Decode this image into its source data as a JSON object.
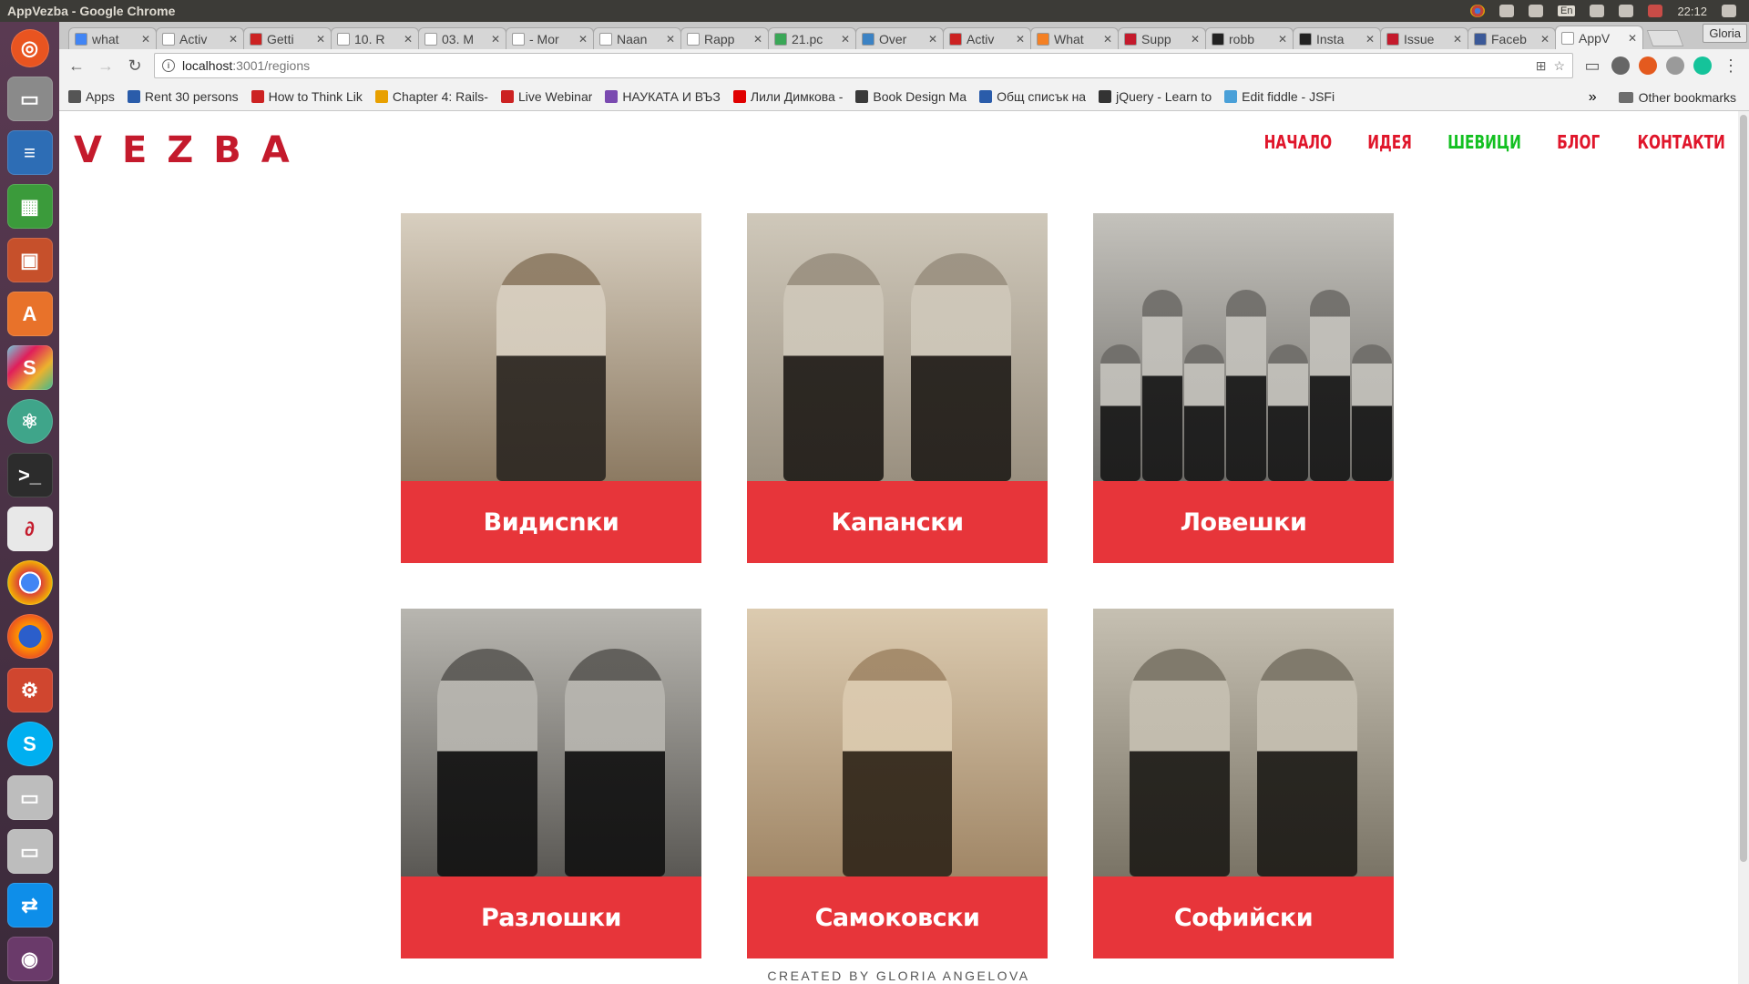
{
  "os": {
    "window_title": "AppVezba - Google Chrome",
    "clock": "22:12",
    "lang": "En"
  },
  "browser": {
    "user": "Gloria",
    "tabs": [
      {
        "label": "what",
        "color": "#4285f4"
      },
      {
        "label": "Activ",
        "color": "#ffffff"
      },
      {
        "label": "Getti",
        "color": "#cc2222"
      },
      {
        "label": "10. R",
        "color": "#ffffff"
      },
      {
        "label": "03. M",
        "color": "#ffffff"
      },
      {
        "label": "- Mor",
        "color": "#ffffff"
      },
      {
        "label": "Naan",
        "color": "#ffffff"
      },
      {
        "label": "Rapp",
        "color": "#ffffff"
      },
      {
        "label": "21.pc",
        "color": "#3aa757"
      },
      {
        "label": "Over",
        "color": "#3b82c4"
      },
      {
        "label": "Activ",
        "color": "#cc2222"
      },
      {
        "label": "What",
        "color": "#f48024"
      },
      {
        "label": "Supp",
        "color": "#c41a2c"
      },
      {
        "label": "robb",
        "color": "#222222"
      },
      {
        "label": "Insta",
        "color": "#222222"
      },
      {
        "label": "Issue",
        "color": "#c41a2c"
      },
      {
        "label": "Faceb",
        "color": "#3b5998"
      },
      {
        "label": "AppV",
        "color": "#ffffff",
        "active": true
      }
    ],
    "url_host": "localhost",
    "url_path": ":3001/regions",
    "bookmarks": [
      {
        "label": "Apps",
        "color": "#555555"
      },
      {
        "label": "Rent 30 persons",
        "color": "#2a5caa"
      },
      {
        "label": "How to Think Lik",
        "color": "#cc2222"
      },
      {
        "label": "Chapter 4: Rails-",
        "color": "#e8a000"
      },
      {
        "label": "Live Webinar",
        "color": "#cc2222"
      },
      {
        "label": "НАУКАТА И ВЪЗ",
        "color": "#7a4ab0"
      },
      {
        "label": "Лили Димкова -",
        "color": "#e00000"
      },
      {
        "label": "Book Design Ma",
        "color": "#3a3a3a"
      },
      {
        "label": "Общ списък на",
        "color": "#2a5caa"
      },
      {
        "label": "jQuery - Learn to",
        "color": "#333333"
      },
      {
        "label": "Edit fiddle - JSFi",
        "color": "#4aa0d8"
      }
    ],
    "bookmarks_more": "»",
    "other_bookmarks": "Other bookmarks"
  },
  "site": {
    "logo": "VEZBA",
    "nav": [
      {
        "label": "НАЧАЛО",
        "active": false
      },
      {
        "label": "ИДЕЯ",
        "active": false
      },
      {
        "label": "ШЕВИЦИ",
        "active": true
      },
      {
        "label": "БЛОГ",
        "active": false
      },
      {
        "label": "КОНТАКТИ",
        "active": false
      }
    ],
    "regions": [
      {
        "name": "Видисnки"
      },
      {
        "name": "Капански"
      },
      {
        "name": "Ловешки"
      },
      {
        "name": "Разлошки"
      },
      {
        "name": "Самоковски"
      },
      {
        "name": "Софийски"
      }
    ],
    "footer": "CREATED BY GLORIA ANGELOVA",
    "accent": "#e7353a",
    "nav_color": "#e0162b",
    "nav_active_color": "#13c021"
  }
}
